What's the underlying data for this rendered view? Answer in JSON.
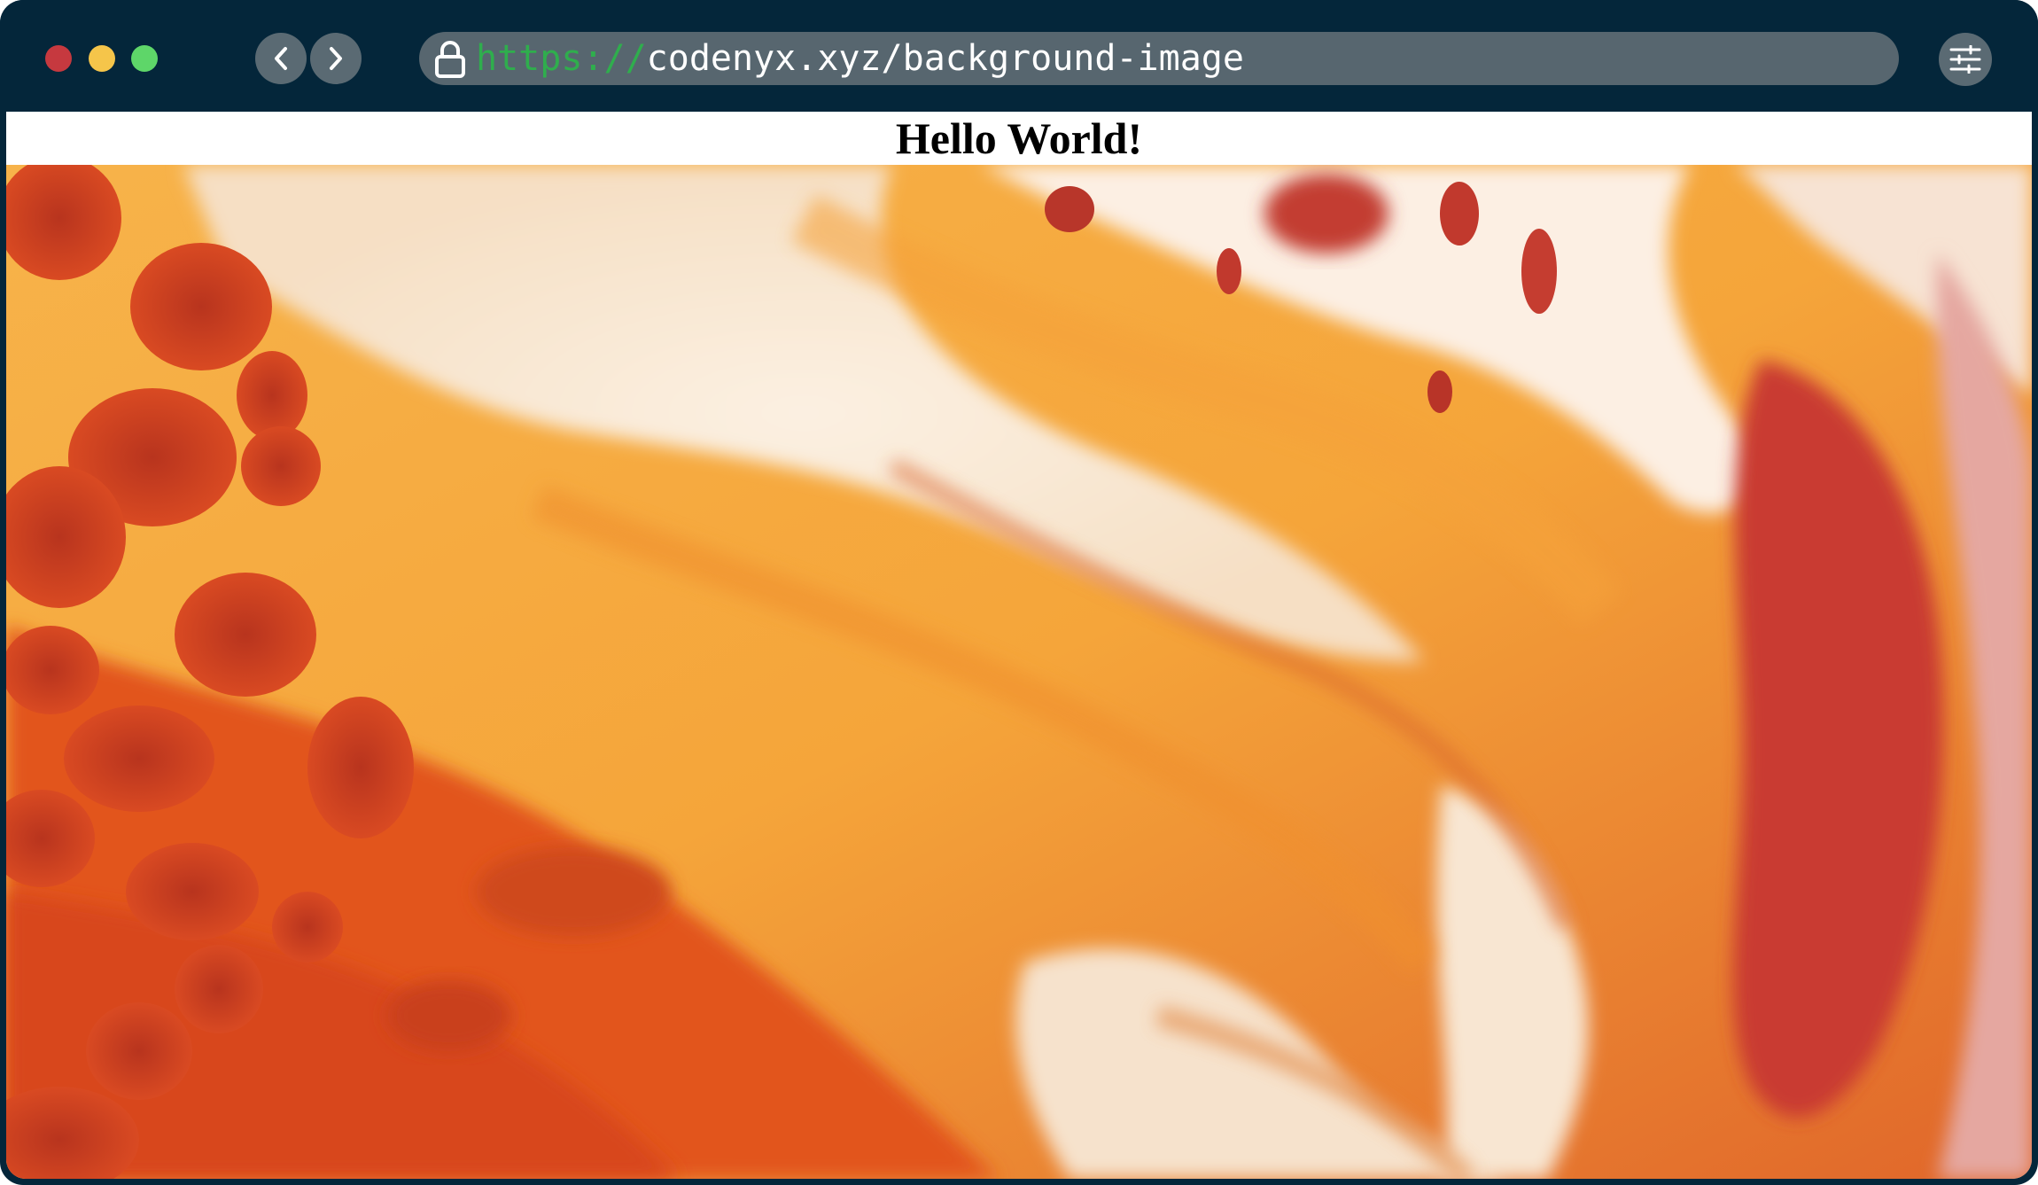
{
  "browser": {
    "url_scheme": "https://",
    "url_path": "codenyx.xyz/background-image",
    "icons": {
      "close": "red-traffic-light",
      "minimize": "yellow-traffic-light",
      "maximize": "green-traffic-light",
      "back": "chevron-left-icon",
      "forward": "chevron-right-icon",
      "lock": "lock-icon",
      "menu": "sliders-icon"
    },
    "colors": {
      "frame": "#04263a",
      "url_bar": "#57666f",
      "scheme": "#2fae4d"
    }
  },
  "page": {
    "heading": "Hello World!",
    "background": "abstract fluid art, orange red and cream marble"
  }
}
